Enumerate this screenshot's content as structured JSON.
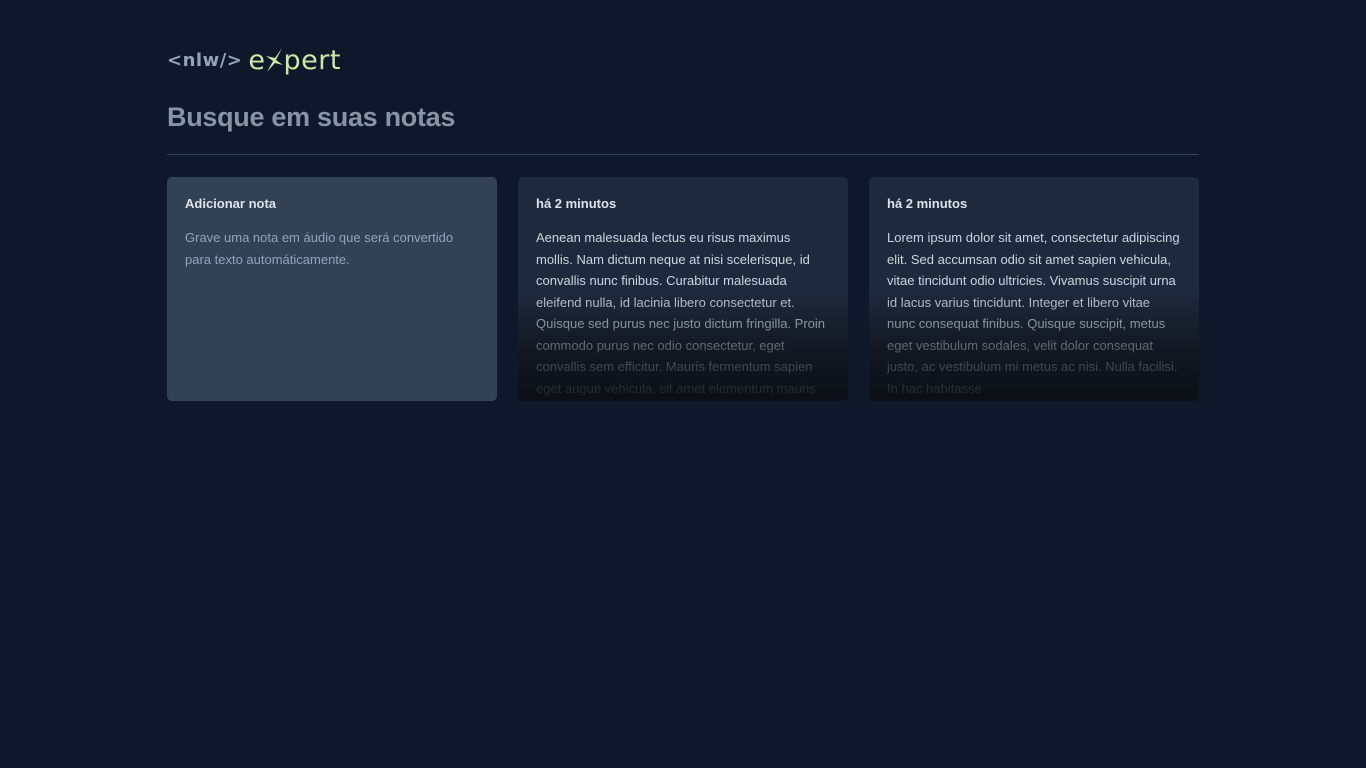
{
  "header": {
    "logo_tag": "<nlw/>",
    "logo_word_start": "e",
    "logo_word_end": "pert"
  },
  "search": {
    "placeholder": "Busque em suas notas",
    "value": ""
  },
  "add_card": {
    "title": "Adicionar nota",
    "body": "Grave uma nota em áudio que será convertido para texto automáticamente."
  },
  "notes": [
    {
      "date": "há 2 minutos",
      "content": "Aenean malesuada lectus eu risus maximus mollis. Nam dictum neque at nisi scelerisque, id convallis nunc finibus. Curabitur malesuada eleifend nulla, id lacinia libero consectetur et. Quisque sed purus nec justo dictum fringilla. Proin commodo purus nec odio consectetur, eget convallis sem efficitur. Mauris fermentum sapien eget augue vehicula, sit amet elementum mauris"
    },
    {
      "date": "há 2 minutos",
      "content": "Lorem ipsum dolor sit amet, consectetur adipiscing elit. Sed accumsan odio sit amet sapien vehicula, vitae tincidunt odio ultricies. Vivamus suscipit urna id lacus varius tincidunt. Integer et libero vitae nunc consequat finibus. Quisque suscipit, metus eget vestibulum sodales, velit dolor consequat justo, ac vestibulum mi metus ac nisi. Nulla facilisi. In hac habitasse"
    }
  ],
  "colors": {
    "background": "#0f172a",
    "add_card_bg": "#334155",
    "note_card_bg": "#1e293b",
    "logo_accent": "#cbe8a6"
  }
}
